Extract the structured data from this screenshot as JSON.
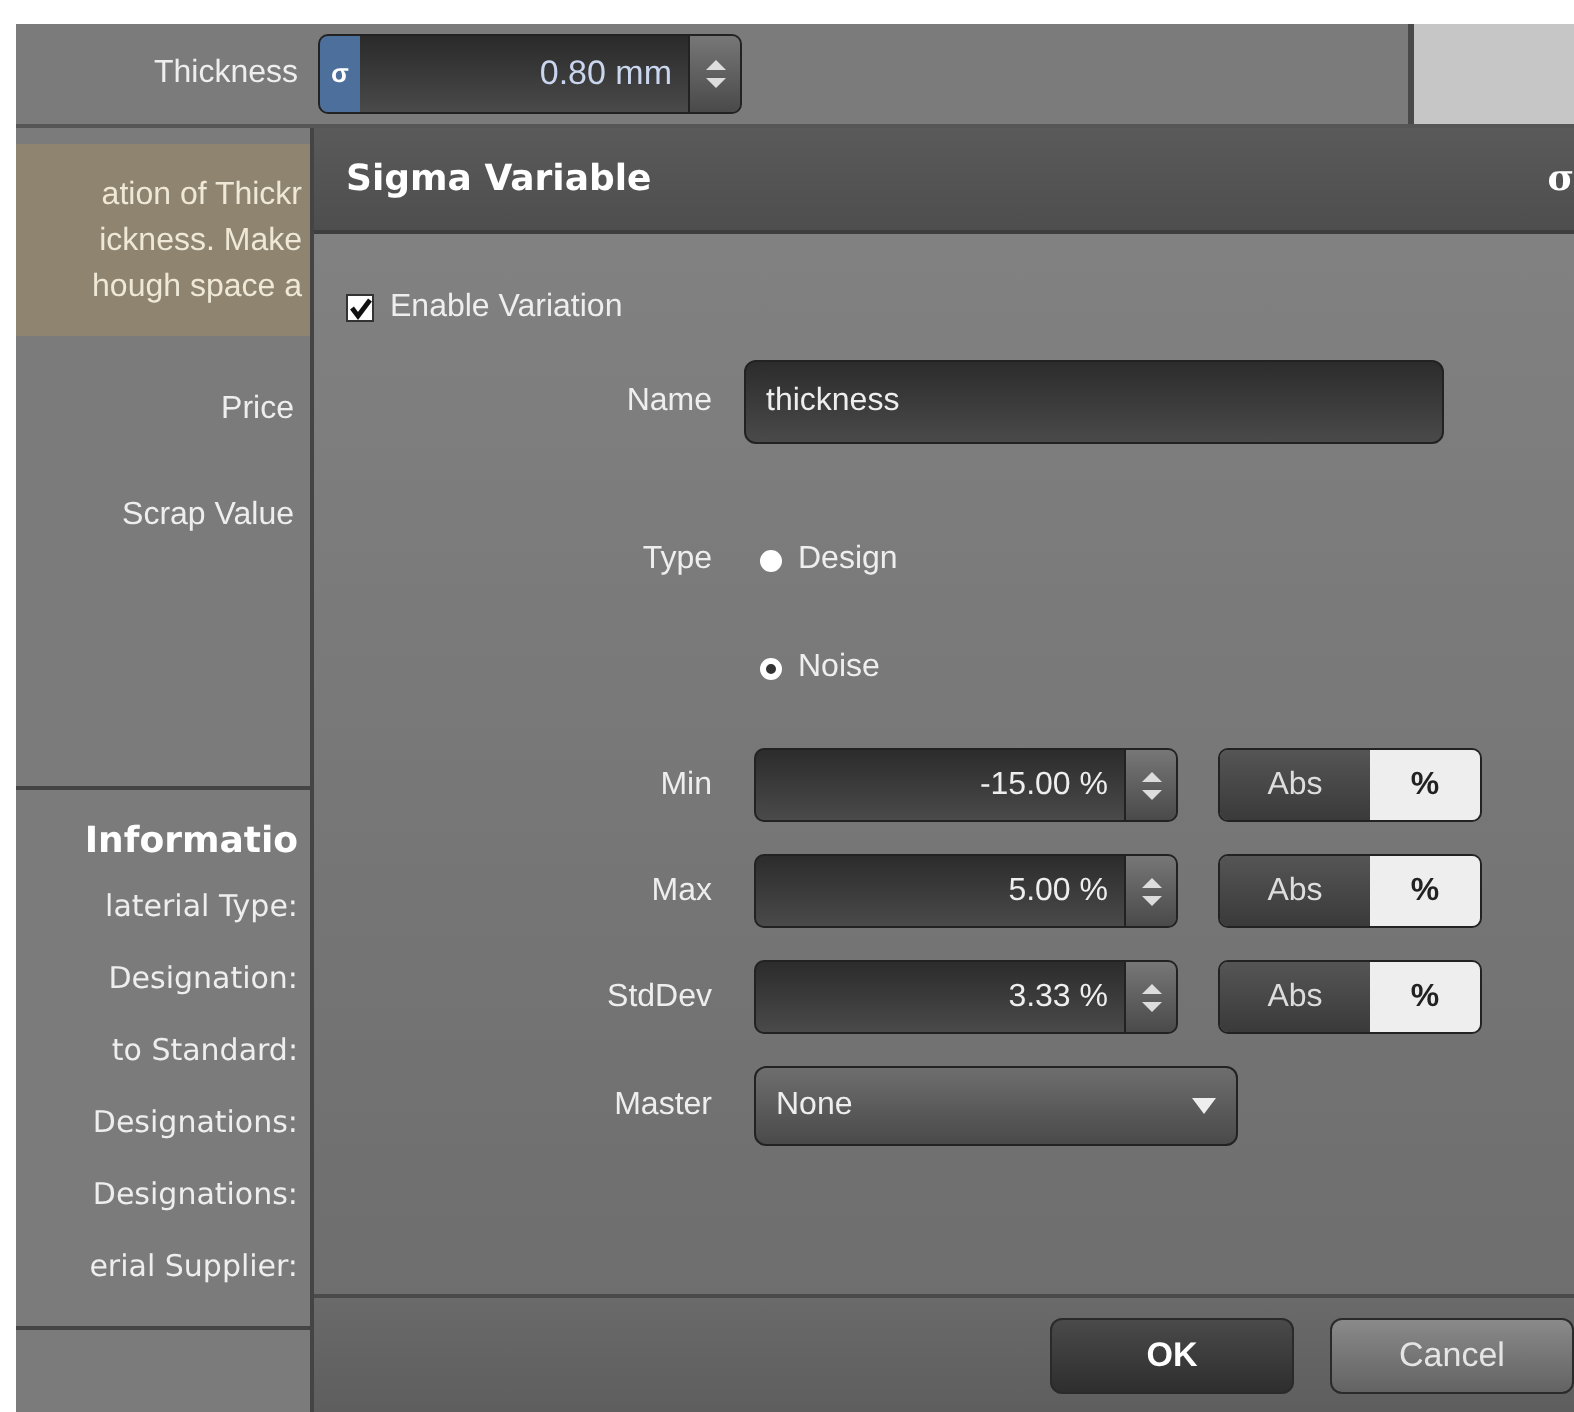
{
  "thickness": {
    "label": "Thickness",
    "sigma_button": "σ",
    "value": "0.80 mm"
  },
  "note": {
    "lines": [
      "ation of Thickr",
      "ickness. Make",
      "hough space a"
    ]
  },
  "properties": [
    {
      "label": "Price"
    },
    {
      "label": "Scrap Value"
    }
  ],
  "information": {
    "heading": "Informatio",
    "labels": [
      "laterial Type:",
      "Designation:",
      "to Standard:",
      "Designations:",
      "Designations:",
      "erial Supplier:"
    ]
  },
  "dialog": {
    "title": "Sigma Variable",
    "title_icon": "σ",
    "enable_variation": {
      "label": "Enable Variation",
      "checked": true
    },
    "name": {
      "label": "Name",
      "value": "thickness"
    },
    "type": {
      "label": "Type",
      "options": [
        {
          "label": "Design",
          "selected": false
        },
        {
          "label": "Noise",
          "selected": true
        }
      ]
    },
    "ranges": [
      {
        "label": "Min",
        "value": "-15.00 %",
        "modes": [
          {
            "label": "Abs",
            "selected": false
          },
          {
            "label": "%",
            "selected": true
          }
        ]
      },
      {
        "label": "Max",
        "value": "5.00 %",
        "modes": [
          {
            "label": "Abs",
            "selected": false
          },
          {
            "label": "%",
            "selected": true
          }
        ]
      },
      {
        "label": "StdDev",
        "value": "3.33 %",
        "modes": [
          {
            "label": "Abs",
            "selected": false
          },
          {
            "label": "%",
            "selected": true
          }
        ]
      }
    ],
    "master": {
      "label": "Master",
      "value": "None"
    },
    "buttons": [
      {
        "label": "OK",
        "kind": "default"
      },
      {
        "label": "Cancel",
        "kind": "normal"
      }
    ]
  }
}
